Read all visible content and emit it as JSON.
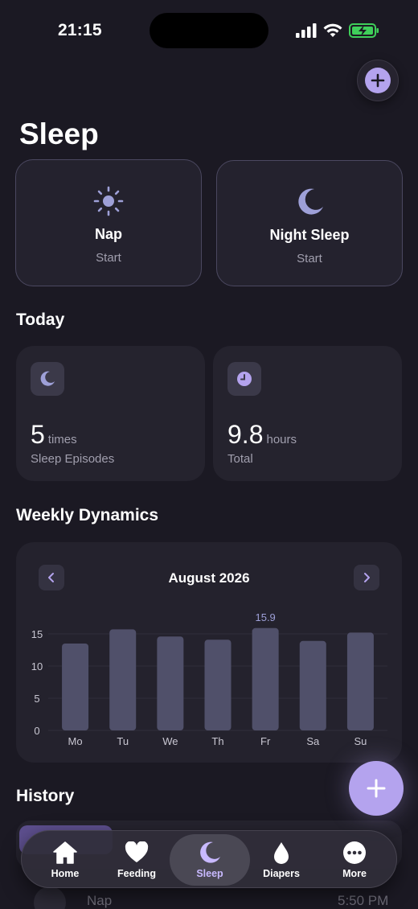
{
  "status_bar": {
    "time": "21:15"
  },
  "page": {
    "title": "Sleep"
  },
  "start_cards": [
    {
      "title": "Nap",
      "subtitle": "Start",
      "icon": "sun-icon"
    },
    {
      "title": "Night Sleep",
      "subtitle": "Start",
      "icon": "moon-icon"
    }
  ],
  "today": {
    "title": "Today",
    "episodes": {
      "value": "5",
      "unit": "times",
      "label": "Sleep Episodes",
      "icon": "moon-icon"
    },
    "total": {
      "value": "9.8",
      "unit": "hours",
      "label": "Total",
      "icon": "clock-icon"
    }
  },
  "weekly": {
    "title": "Weekly Dynamics",
    "month": "August 2026"
  },
  "chart_data": {
    "type": "bar",
    "categories": [
      "Mo",
      "Tu",
      "We",
      "Th",
      "Fr",
      "Sa",
      "Su"
    ],
    "values": [
      13.5,
      15.7,
      14.6,
      14.1,
      15.9,
      13.9,
      15.2
    ],
    "highlight_label": "15.9",
    "highlight_index": 4,
    "yticks": [
      0,
      5,
      10,
      15
    ],
    "ylim": [
      0,
      17
    ],
    "grid": true
  },
  "history": {
    "title": "History",
    "rows": [
      {
        "name": "Nap",
        "time": "5:50 PM"
      }
    ]
  },
  "tabs": [
    {
      "label": "Home",
      "icon": "home-icon"
    },
    {
      "label": "Feeding",
      "icon": "heart-icon"
    },
    {
      "label": "Sleep",
      "icon": "moon-icon",
      "active": true
    },
    {
      "label": "Diapers",
      "icon": "drop-icon"
    },
    {
      "label": "More",
      "icon": "more-icon"
    }
  ],
  "colors": {
    "background": "#1b1923",
    "accent": "#b4a3ee",
    "bar": "#50506a",
    "muted_text": "#a19fae"
  }
}
